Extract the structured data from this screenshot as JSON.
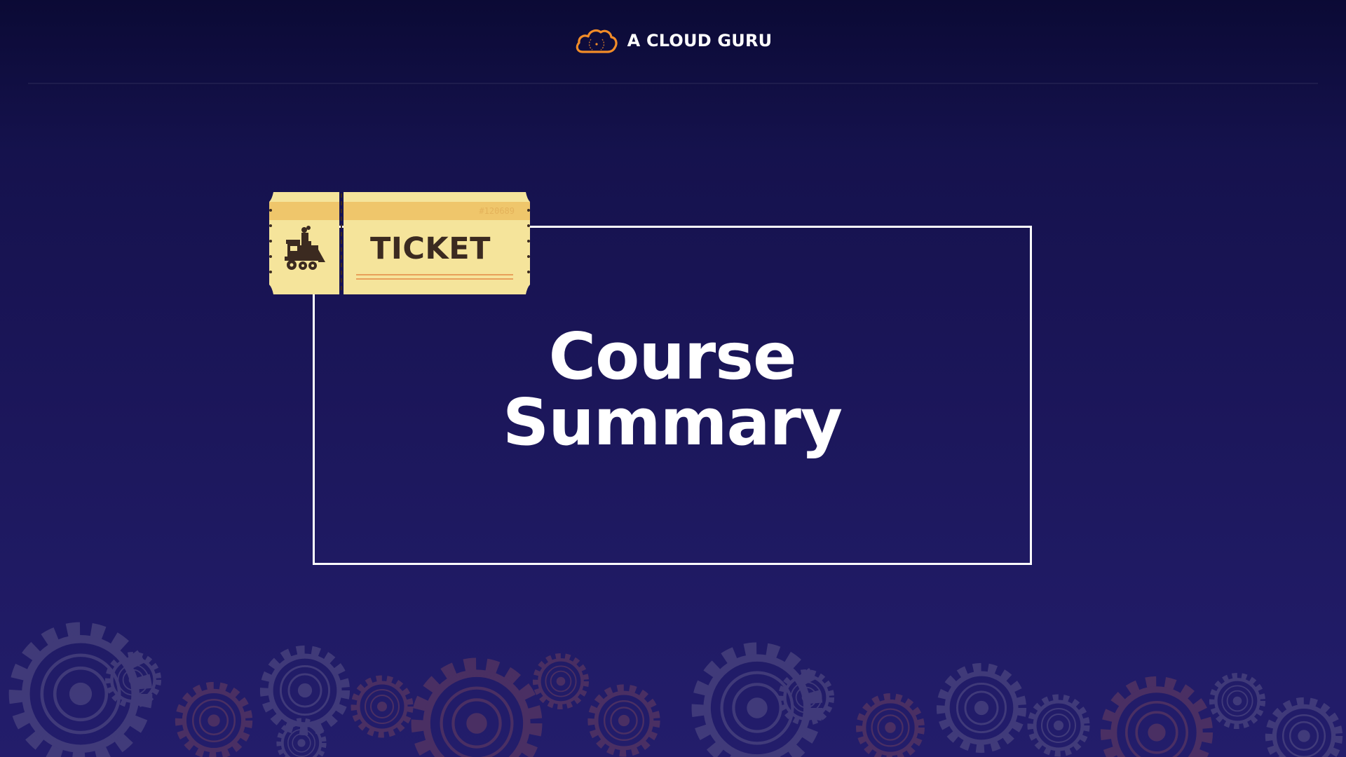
{
  "header": {
    "brand_name": "A CLOUD GURU",
    "logo_icon": "cloud-logo-icon"
  },
  "ticket": {
    "label": "TICKET",
    "number": "#120689",
    "icon": "train-icon"
  },
  "title": {
    "line1": "Course",
    "line2": "Summary"
  },
  "decoration": {
    "icon": "gears-icon"
  },
  "colors": {
    "background_top": "#0b0a35",
    "background_bottom": "#231d6b",
    "brand_orange": "#f28c28",
    "ticket_yellow": "#f5e49b",
    "ticket_band": "#efc66b",
    "ticket_text": "#3b2a20",
    "gear_gray": "#5a5488",
    "gear_brown": "#6b3f5f",
    "title_white": "#ffffff"
  }
}
